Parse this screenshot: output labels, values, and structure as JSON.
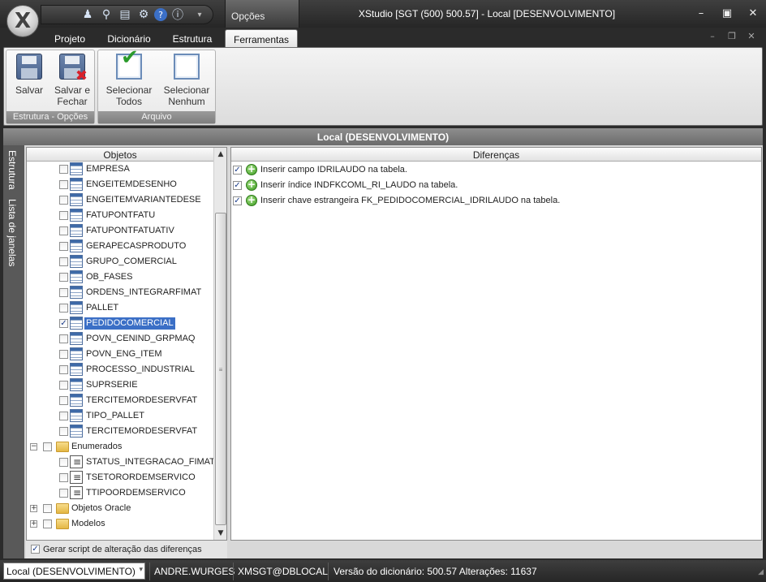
{
  "window": {
    "title": "XStudio [SGT (500) 500.57] - Local [DESENVOLVIMENTO]",
    "context_tab": "Opções",
    "controls": [
      "minimize",
      "maximize",
      "close"
    ]
  },
  "quick_access": [
    "users-icon",
    "search-icon",
    "document-icon",
    "gear-icon",
    "help-icon",
    "info-icon",
    "customize-dropdown-icon"
  ],
  "tabs": [
    {
      "label": "Projeto",
      "active": false
    },
    {
      "label": "Dicionário",
      "active": false
    },
    {
      "label": "Estrutura",
      "active": false
    },
    {
      "label": "Ferramentas",
      "active": true
    }
  ],
  "ribbon": {
    "groups": [
      {
        "label": "Estrutura - Opções",
        "buttons": [
          {
            "label": "Salvar",
            "icon": "floppy-icon"
          },
          {
            "label": "Salvar e\nFechar",
            "icon": "floppy-close-icon"
          }
        ]
      },
      {
        "label": "Arquivo",
        "buttons": [
          {
            "label": "Selecionar\nTodos",
            "icon": "check-all-icon"
          },
          {
            "label": "Selecionar\nNenhum",
            "icon": "check-none-icon"
          }
        ]
      }
    ]
  },
  "content": {
    "title": "Local (DESENVOLVIMENTO)",
    "side_tabs": [
      "Estrutura",
      "Lista de janelas"
    ],
    "objects_header": "Objetos",
    "differences_header": "Diferenças",
    "tree": [
      {
        "label": "EMPRESA",
        "type": "table",
        "level": 2,
        "checked": false
      },
      {
        "label": "ENGEITEMDESENHO",
        "type": "table",
        "level": 2,
        "checked": false
      },
      {
        "label": "ENGEITEMVARIANTEDESE",
        "type": "table",
        "level": 2,
        "checked": false
      },
      {
        "label": "FATUPONTFATU",
        "type": "table",
        "level": 2,
        "checked": false
      },
      {
        "label": "FATUPONTFATUATIV",
        "type": "table",
        "level": 2,
        "checked": false
      },
      {
        "label": "GERAPECASPRODUTO",
        "type": "table",
        "level": 2,
        "checked": false
      },
      {
        "label": "GRUPO_COMERCIAL",
        "type": "table",
        "level": 2,
        "checked": false
      },
      {
        "label": "OB_FASES",
        "type": "table",
        "level": 2,
        "checked": false
      },
      {
        "label": "ORDENS_INTEGRARFIMAT",
        "type": "table",
        "level": 2,
        "checked": false
      },
      {
        "label": "PALLET",
        "type": "table",
        "level": 2,
        "checked": false
      },
      {
        "label": "PEDIDOCOMERCIAL",
        "type": "table",
        "level": 2,
        "checked": true,
        "selected": true
      },
      {
        "label": "POVN_CENIND_GRPMAQ",
        "type": "table",
        "level": 2,
        "checked": false
      },
      {
        "label": "POVN_ENG_ITEM",
        "type": "table",
        "level": 2,
        "checked": false
      },
      {
        "label": "PROCESSO_INDUSTRIAL",
        "type": "table",
        "level": 2,
        "checked": false
      },
      {
        "label": "SUPRSERIE",
        "type": "table",
        "level": 2,
        "checked": false
      },
      {
        "label": "TERCITEMORDESERVFAT",
        "type": "table",
        "level": 2,
        "checked": false
      },
      {
        "label": "TIPO_PALLET",
        "type": "table",
        "level": 2,
        "checked": false
      },
      {
        "label": "TERCITEMORDESERVFAT",
        "type": "table",
        "level": 2,
        "checked": false
      },
      {
        "label": "Enumerados",
        "type": "folder",
        "level": 1,
        "checked": false,
        "expander": "minus"
      },
      {
        "label": "STATUS_INTEGRACAO_FIMAT",
        "type": "enum",
        "level": 2,
        "checked": false
      },
      {
        "label": "TSETORORDEMSERVICO",
        "type": "enum",
        "level": 2,
        "checked": false
      },
      {
        "label": "TTIPOORDEMSERVICO",
        "type": "enum",
        "level": 2,
        "checked": false
      },
      {
        "label": "Objetos Oracle",
        "type": "folder",
        "level": 1,
        "checked": false,
        "expander": "plus"
      },
      {
        "label": "Modelos",
        "type": "folder",
        "level": 1,
        "checked": false,
        "expander": "plus"
      }
    ],
    "differences": [
      {
        "text": "Inserir campo IDRILAUDO na tabela.",
        "checked": true
      },
      {
        "text": "Inserir índice INDFKCOML_RI_LAUDO na tabela.",
        "checked": true
      },
      {
        "text": "Inserir chave estrangeira FK_PEDIDOCOMERCIAL_IDRILAUDO na tabela.",
        "checked": true
      }
    ],
    "footer_checkbox": {
      "label": "Gerar script de alteração das diferenças",
      "checked": true
    }
  },
  "status": {
    "connection": "Local (DESENVOLVIMENTO)",
    "user": "ANDRE.WURGES",
    "db": "XMSGT@DBLOCAL",
    "info": "Versão do dicionário: 500.57 Alterações: 11637"
  }
}
